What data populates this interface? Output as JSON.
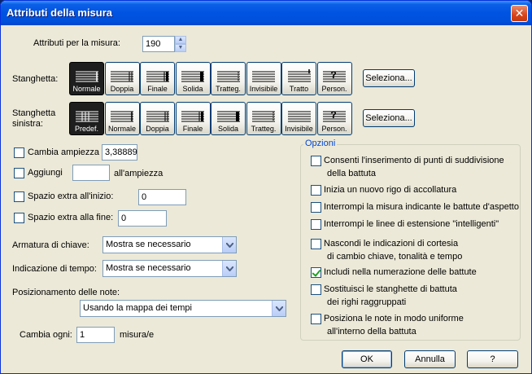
{
  "window": {
    "title": "Attributi della misura",
    "close": "✕"
  },
  "attributes_for": {
    "label": "Attributi per la misura:",
    "value": "190"
  },
  "barline": {
    "label": "Stanghetta:",
    "options": [
      "Normale",
      "Doppia",
      "Finale",
      "Solida",
      "Tratteg.",
      "Invisibile",
      "Tratto",
      "Person."
    ],
    "selected": "Normale",
    "select_button": "Seleziona..."
  },
  "left_barline": {
    "label_line1": "Stanghetta",
    "label_line2": "sinistra:",
    "options": [
      "Predef.",
      "Normale",
      "Doppia",
      "Finale",
      "Solida",
      "Tratteg.",
      "Invisibile",
      "Person."
    ],
    "selected": "Predef.",
    "select_button": "Seleziona..."
  },
  "change_width": {
    "label": "Cambia ampiezza",
    "value": "3,38889",
    "checked": false
  },
  "add": {
    "label": "Aggiungi",
    "value": "",
    "suffix": "all'ampiezza",
    "checked": false
  },
  "extra_start": {
    "label": "Spazio extra all'inizio:",
    "value": "0",
    "checked": false
  },
  "extra_end": {
    "label": "Spazio extra alla fine:",
    "value": "0",
    "checked": false
  },
  "key_signature": {
    "label": "Armatura di chiave:",
    "value": "Mostra se necessario"
  },
  "time_signature": {
    "label": "Indicazione di tempo:",
    "value": "Mostra se necessario"
  },
  "note_positioning": {
    "label": "Posizionamento delle note:",
    "value": "Usando la mappa dei tempi"
  },
  "change_every": {
    "label": "Cambia ogni:",
    "value": "1",
    "suffix": "misura/e"
  },
  "options": {
    "title": "Opzioni",
    "items": [
      {
        "line1": "Consenti l'inserimento di punti di suddivisione",
        "line2": "della battuta",
        "checked": false
      },
      {
        "line1": "Inizia un nuovo rigo di accollatura",
        "line2": "",
        "checked": false
      },
      {
        "line1": "Interrompi la misura indicante le battute d'aspetto",
        "line2": "",
        "checked": false
      },
      {
        "line1": "Interrompi le linee di estensione \"intelligenti\"",
        "line2": "",
        "checked": false
      },
      {
        "line1": "Nascondi le indicazioni di cortesia",
        "line2": "di cambio chiave, tonalità e tempo",
        "checked": false
      },
      {
        "line1": "Includi nella numerazione delle battute",
        "line2": "",
        "checked": true
      },
      {
        "line1": "Sostituisci le stanghette di battuta",
        "line2": "dei righi raggruppati",
        "checked": false
      },
      {
        "line1": "Posiziona le note in modo uniforme",
        "line2": "all'interno della battuta",
        "checked": false
      }
    ]
  },
  "buttons": {
    "ok": "OK",
    "cancel": "Annulla",
    "help": "?"
  }
}
